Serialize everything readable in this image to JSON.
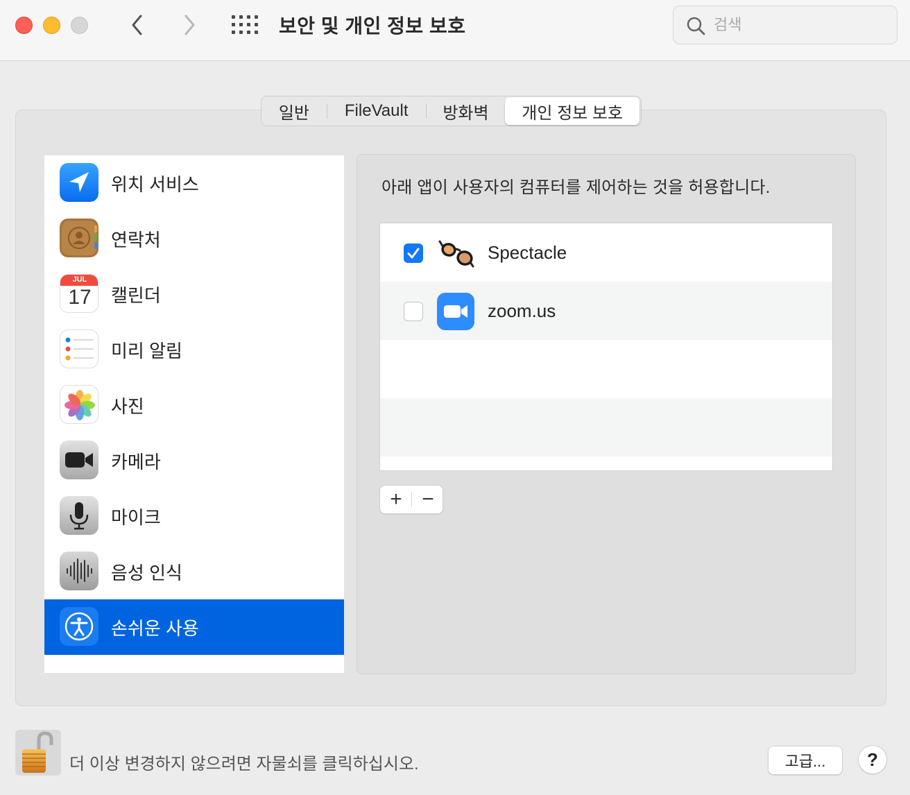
{
  "window": {
    "title": "보안 및 개인 정보 보호",
    "search_placeholder": "검색"
  },
  "tabs": [
    "일반",
    "FileVault",
    "방화벽",
    "개인 정보 보호"
  ],
  "selected_tab": "개인 정보 보호",
  "categories": [
    {
      "label": "위치 서비스",
      "icon": "location-arrow-icon"
    },
    {
      "label": "연락처",
      "icon": "contacts-icon"
    },
    {
      "label": "캘린더",
      "icon": "calendar-icon",
      "month": "JUL",
      "day": "17"
    },
    {
      "label": "미리 알림",
      "icon": "reminders-icon"
    },
    {
      "label": "사진",
      "icon": "photos-icon"
    },
    {
      "label": "카메라",
      "icon": "camera-icon"
    },
    {
      "label": "마이크",
      "icon": "microphone-icon"
    },
    {
      "label": "음성 인식",
      "icon": "speech-recognition-icon"
    },
    {
      "label": "손쉬운 사용",
      "icon": "accessibility-icon",
      "selected": true
    }
  ],
  "panel": {
    "description": "아래 앱이 사용자의 컴퓨터를 제어하는 것을 허용합니다.",
    "apps": [
      {
        "name": "Spectacle",
        "checked": true,
        "icon": "spectacle-glasses-icon"
      },
      {
        "name": "zoom.us",
        "checked": false,
        "icon": "zoom-camera-icon"
      }
    ],
    "add_label": "+",
    "remove_label": "−"
  },
  "footer": {
    "lock_text": "더 이상 변경하지 않으려면 자물쇠를 클릭하십시오.",
    "advanced_label": "고급...",
    "help_label": "?"
  },
  "colors": {
    "selection": "#0064e1",
    "checkbox_on": "#1477f8",
    "close": "#fe5f57",
    "minimize": "#febc2e"
  }
}
